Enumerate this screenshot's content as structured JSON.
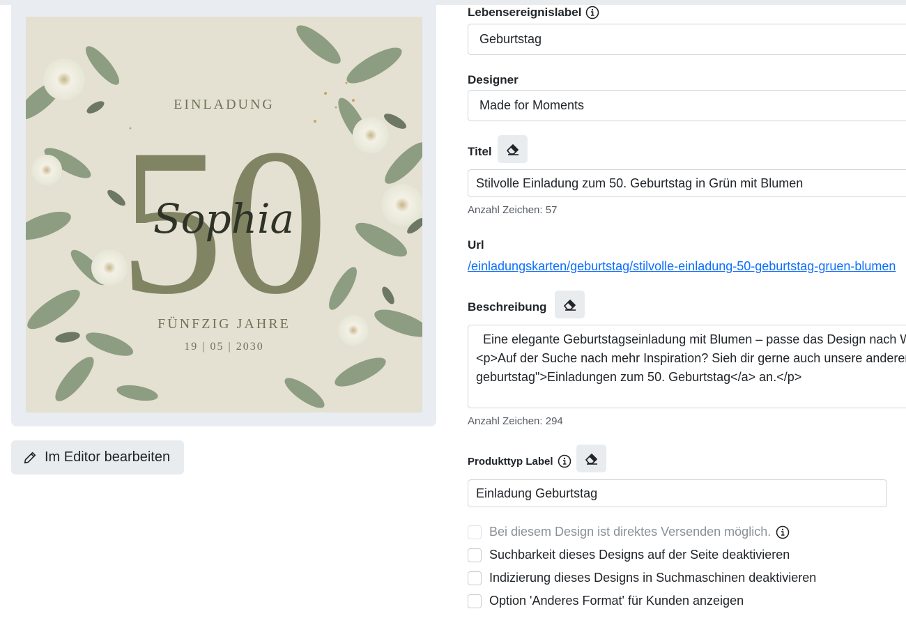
{
  "preview": {
    "card_heading": "EINLADUNG",
    "card_number": "50",
    "card_name": "Sophia",
    "card_subheading": "FÜNFZIG JAHRE",
    "card_date": "19 | 05 | 2030",
    "edit_button_label": "Im Editor bearbeiten",
    "edit_icon": "pencil-icon"
  },
  "form": {
    "life_event": {
      "label": "Lebensereignislabel",
      "value": "Geburtstag",
      "info_icon": "info-icon"
    },
    "designer": {
      "label": "Designer",
      "value": "Made for Moments"
    },
    "title": {
      "label": "Titel",
      "value": "Stilvolle Einladung zum 50. Geburtstag in Grün mit Blumen",
      "char_count": "Anzahl Zeichen: 57",
      "clear_icon": "eraser-icon"
    },
    "url": {
      "label": "Url",
      "value": "/einladungskarten/geburtstag/stilvolle-einladung-50-geburtstag-gruen-blumen"
    },
    "description": {
      "label": "Beschreibung",
      "value": "  Eine elegante Geburtstagseinladung mit Blumen – passe das Design nach W\n<p>Auf der Suche nach mehr Inspiration? Sieh dir gerne auch unsere anderen\ngeburtstag\">Einladungen zum 50. Geburtstag</a> an.</p>",
      "char_count": "Anzahl Zeichen: 294"
    },
    "product_type": {
      "label": "Produkttyp Label",
      "value": "Einladung Geburtstag"
    },
    "checkboxes": [
      {
        "label": "Bei diesem Design ist direktes Versenden möglich.",
        "checked": false,
        "disabled": true
      },
      {
        "label": "Suchbarkeit dieses Designs auf der Seite deaktivieren",
        "checked": false,
        "disabled": false
      },
      {
        "label": "Indizierung dieses Designs in Suchmaschinen deaktivieren",
        "checked": false,
        "disabled": false
      },
      {
        "label": "Option 'Anderes Format' für Kunden anzeigen",
        "checked": false,
        "disabled": false
      }
    ]
  },
  "colors": {
    "card_bg": "#e4e0d2",
    "number_color": "#7c805e",
    "link": "#0d6efd",
    "button_bg": "#e9ecef"
  }
}
